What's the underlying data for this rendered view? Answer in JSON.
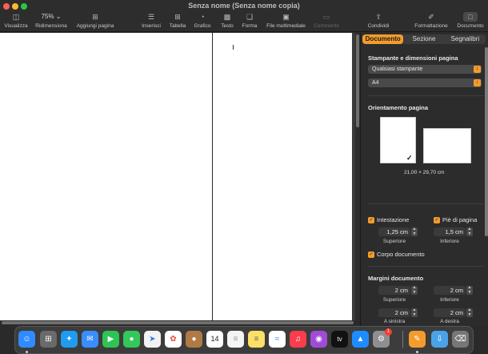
{
  "window": {
    "title": "Senza nome (Senza nome copia)"
  },
  "toolbar": {
    "visualizza": "Visualizza",
    "zoom_value": "75%",
    "ridimensiona": "Ridimensiona",
    "aggiungi_pagina": "Aggiungi pagina",
    "inserisci": "Inserisci",
    "tabella": "Tabella",
    "grafico": "Grafico",
    "testo": "Testo",
    "forma": "Forma",
    "file_multimediale": "File multimediale",
    "commento": "Commento",
    "condividi": "Condividi",
    "formattazione": "Formattazione",
    "documento": "Documento"
  },
  "inspector": {
    "tabs": [
      "Documento",
      "Sezione",
      "Segnalibri"
    ],
    "active_tab": "Documento",
    "printer_section_title": "Stampante e dimensioni pagina",
    "printer_value": "Qualsiasi stampante",
    "paper_value": "A4",
    "orientation_title": "Orientamento pagina",
    "page_size": "21,00 × 29,70 cm",
    "header": {
      "label": "Intestazione",
      "value": "1,25 cm",
      "caption": "Superiore",
      "checked": true
    },
    "footer": {
      "label": "Piè di pagina",
      "value": "1,5 cm",
      "caption": "Inferiore",
      "checked": true
    },
    "body": {
      "label": "Corpo documento",
      "checked": true
    },
    "margins_title": "Margini documento",
    "margins": {
      "top": {
        "value": "2 cm",
        "caption": "Superiore"
      },
      "bottom": {
        "value": "2 cm",
        "caption": "Inferiore"
      },
      "left": {
        "value": "2 cm",
        "caption": "A sinistra"
      },
      "right": {
        "value": "2 cm",
        "caption": "A destra"
      }
    }
  },
  "dock": {
    "calendar_day": "14",
    "appstore_badge": "1",
    "appletv_label": "tv"
  },
  "colors": {
    "accent": "#f39c2c",
    "toolbar_bg": "#2d2d2d",
    "inspector_bg": "#2c2c2c",
    "page_bg": "#ffffff"
  }
}
